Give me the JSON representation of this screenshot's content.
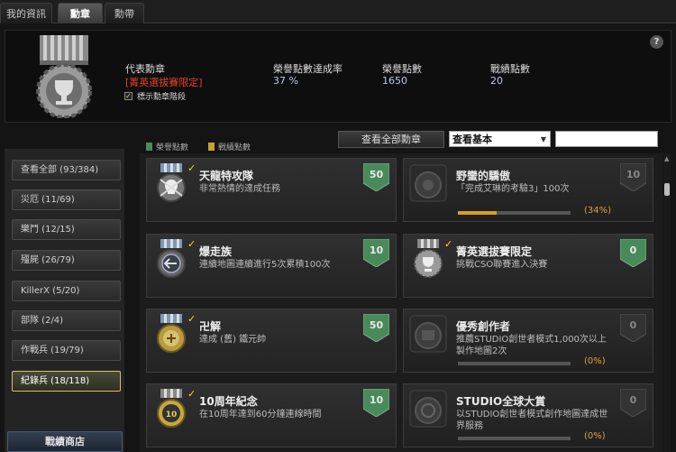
{
  "tabs": [
    {
      "label": "我的資訊"
    },
    {
      "label": "勳章"
    },
    {
      "label": "勳帶"
    }
  ],
  "header": {
    "help": "?",
    "rep_medal_label": "代表勳章",
    "rep_medal_value": "[菁英選拔賽限定]",
    "completion_label": "榮譽點數達成率",
    "completion_value": "37 %",
    "honor_label": "榮譽點數",
    "honor_value": "1650",
    "merit_label": "戰績點數",
    "merit_value": "20",
    "show_stage_label": "標示勳章階段"
  },
  "legend": {
    "honor": "榮譽點數",
    "merit": "戰績點數"
  },
  "toolbar": {
    "view_all": "查看全部勳章",
    "select_value": "查看基本"
  },
  "sidebar": {
    "items": [
      {
        "label": "查看全部 (93/384)"
      },
      {
        "label": "災厄 (11/69)"
      },
      {
        "label": "樂鬥 (12/15)"
      },
      {
        "label": "殭屍 (26/79)"
      },
      {
        "label": "KillerX (5/20)"
      },
      {
        "label": "部隊 (2/4)"
      },
      {
        "label": "作戰兵 (19/79)"
      },
      {
        "label": "紀錄兵 (18/118)"
      }
    ],
    "shop": "戰績商店"
  },
  "cards": [
    {
      "title": "天龍特攻隊",
      "desc": "非常熱情的達成任務",
      "points": "50",
      "done": true
    },
    {
      "title": "野蠻的驕傲",
      "desc": "「完成艾琳的考驗3」100次",
      "points": "10",
      "done": false,
      "progress": 0.34,
      "progress_label": "(34%)"
    },
    {
      "title": "爆走族",
      "desc": "連續地圖連續進行5次累積100次",
      "points": "10",
      "done": true
    },
    {
      "title": "菁英選拔賽限定",
      "desc": "挑戰CSO聯賽進入決賽",
      "points": "0",
      "done": true
    },
    {
      "title": "卍解",
      "desc": "達成 (舊) 鐵元帥",
      "points": "50",
      "done": true
    },
    {
      "title": "優秀創作者",
      "desc": "推薦STUDIO創世者模式1,000次以上製作地圖2次",
      "points": "0",
      "done": false,
      "progress": 0,
      "progress_label": "(0%)"
    },
    {
      "title": "10周年紀念",
      "desc": "在10周年達到60分鐘連線時間",
      "points": "10",
      "done": true
    },
    {
      "title": "STUDIO全球大賞",
      "desc": "以STUDIO創世者模式創作地圖達成世界服務",
      "points": "0",
      "done": false,
      "progress": 0,
      "progress_label": "(0%)"
    }
  ],
  "colors": {
    "accent_red": "#e24028",
    "gold": "#ffcf3a",
    "honor_green": "#4a8a5a",
    "merit_gold": "#c8a030"
  }
}
